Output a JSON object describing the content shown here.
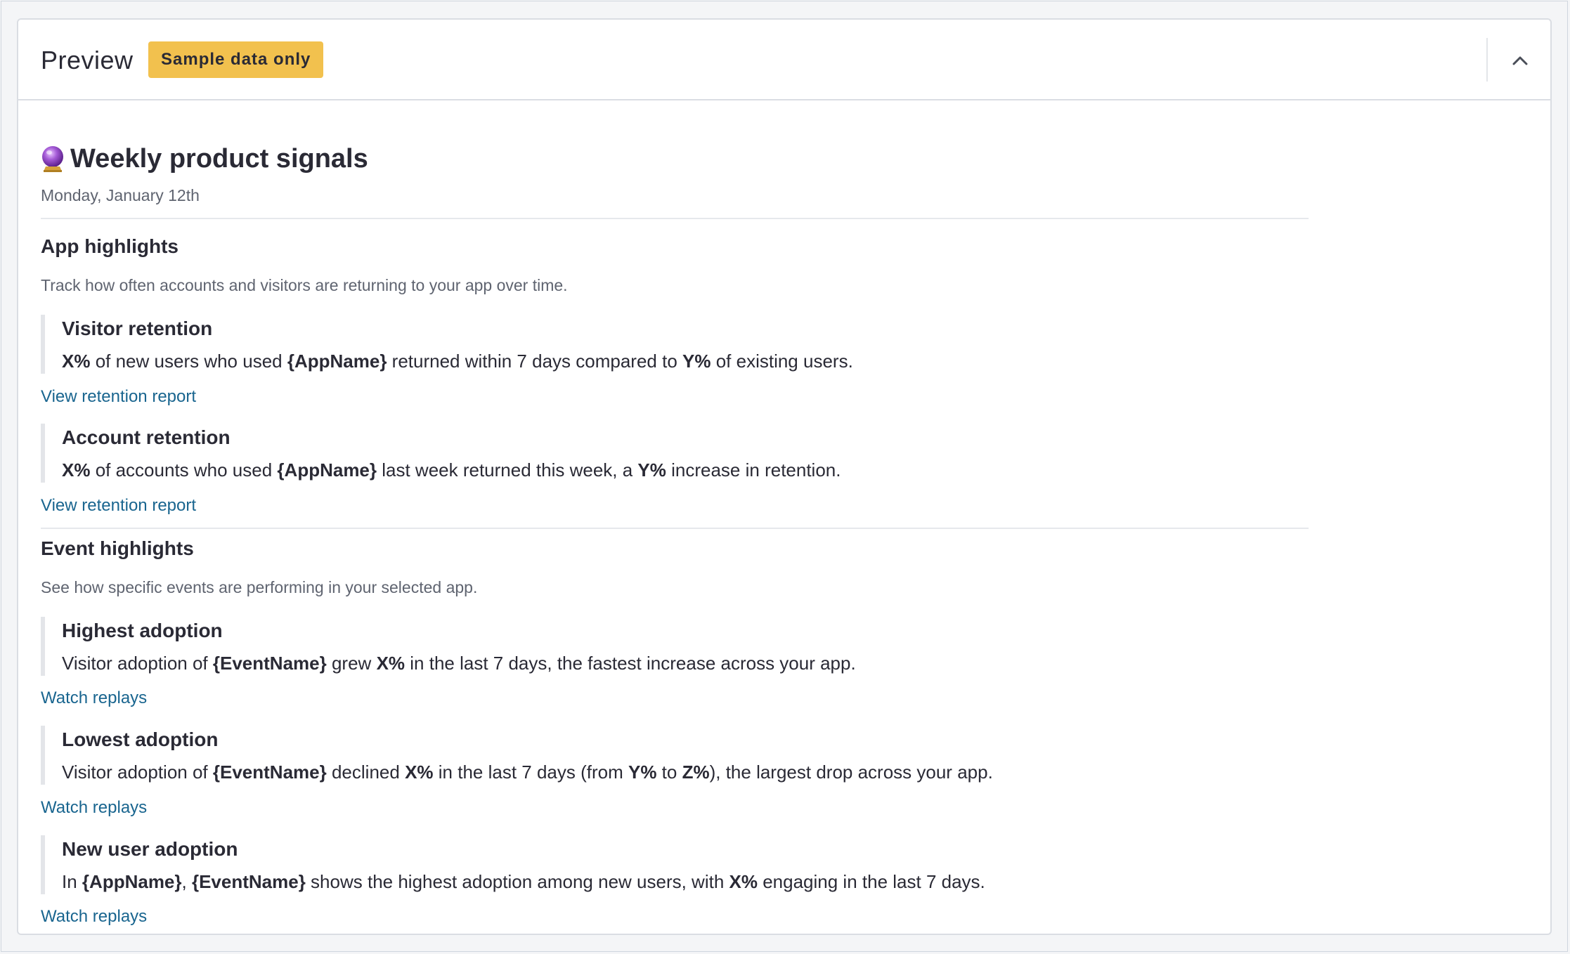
{
  "header": {
    "title": "Preview",
    "badge": "Sample data only",
    "collapse_icon": "chevron-up-icon"
  },
  "report": {
    "icon": "crystal-ball-icon",
    "title": "Weekly product signals",
    "date": "Monday, January 12th"
  },
  "app_highlights": {
    "title": "App highlights",
    "description": "Track how often accounts and visitors are returning to your app over time.",
    "items": [
      {
        "title": "Visitor retention",
        "text": [
          {
            "t": "X%",
            "b": true
          },
          {
            "t": " of new users who used ",
            "b": false
          },
          {
            "t": "{AppName}",
            "b": true
          },
          {
            "t": " returned within 7 days compared to ",
            "b": false
          },
          {
            "t": "Y%",
            "b": true
          },
          {
            "t": " of existing users.",
            "b": false
          }
        ],
        "link": "View retention report"
      },
      {
        "title": "Account retention",
        "text": [
          {
            "t": "X%",
            "b": true
          },
          {
            "t": " of accounts who used ",
            "b": false
          },
          {
            "t": "{AppName}",
            "b": true
          },
          {
            "t": " last week returned this week, a ",
            "b": false
          },
          {
            "t": "Y%",
            "b": true
          },
          {
            "t": " increase in retention.",
            "b": false
          }
        ],
        "link": "View retention report"
      }
    ]
  },
  "event_highlights": {
    "title": "Event highlights",
    "description": "See how specific events are performing in your selected app.",
    "items": [
      {
        "title": "Highest adoption",
        "text": [
          {
            "t": "Visitor adoption of ",
            "b": false
          },
          {
            "t": "{EventName}",
            "b": true
          },
          {
            "t": " grew ",
            "b": false
          },
          {
            "t": "X%",
            "b": true
          },
          {
            "t": " in the last 7 days, the fastest increase across your app.",
            "b": false
          }
        ],
        "link": "Watch replays"
      },
      {
        "title": "Lowest adoption",
        "text": [
          {
            "t": "Visitor adoption of ",
            "b": false
          },
          {
            "t": "{EventName}",
            "b": true
          },
          {
            "t": " declined ",
            "b": false
          },
          {
            "t": "X%",
            "b": true
          },
          {
            "t": " in the last 7 days (from ",
            "b": false
          },
          {
            "t": "Y%",
            "b": true
          },
          {
            "t": " to ",
            "b": false
          },
          {
            "t": "Z%",
            "b": true
          },
          {
            "t": "), the largest drop across your app.",
            "b": false
          }
        ],
        "link": "Watch replays"
      },
      {
        "title": "New user adoption",
        "text": [
          {
            "t": "In ",
            "b": false
          },
          {
            "t": "{AppName}",
            "b": true
          },
          {
            "t": ", ",
            "b": false
          },
          {
            "t": "{EventName}",
            "b": true
          },
          {
            "t": " shows the highest adoption among new users, with ",
            "b": false
          },
          {
            "t": "X%",
            "b": true
          },
          {
            "t": " engaging in the last 7 days.",
            "b": false
          }
        ],
        "link": "Watch replays"
      }
    ]
  },
  "colors": {
    "badge": "#f2c14e",
    "link": "#19658f",
    "text": "#2a2a35",
    "muted": "#5f6470"
  }
}
